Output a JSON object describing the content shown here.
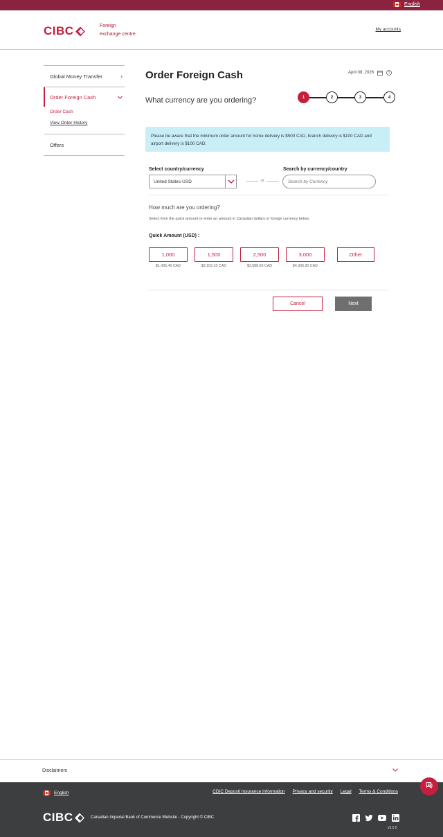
{
  "topbar": {
    "language": "English"
  },
  "header": {
    "logo_text": "CIBC",
    "app_title_line1": "Foreign",
    "app_title_line2": "exchange centre",
    "my_accounts": "My accounts"
  },
  "sidebar": {
    "global_money_transfer": "Global Money Transfer",
    "order_foreign_cash": "Order Foreign Cash",
    "order_cash": "Order Cash",
    "view_order_history": "View Order History",
    "offers": "Offers"
  },
  "main": {
    "title": "Order Foreign Cash",
    "date": "April 08, 2026",
    "question": "What currency are you ordering?",
    "steps": [
      "1",
      "2",
      "3",
      "4"
    ],
    "current_step": 1,
    "notice": "Please be aware that the minimum order amount for home delivery is $500 CAD, branch delivery is $100 CAD and airport delivery is $100 CAD.",
    "select_label": "Select country/currency",
    "select_value": "United States-USD",
    "or_text": "or",
    "search_label": "Search by currency/country",
    "search_placeholder": "Search by Currency",
    "amount_question": "How much are you ordering?",
    "amount_help": "Select from the quick amount or enter an amount in Canadian dollars or foreign currency below.",
    "quick_label": "Quick Amount (USD) :",
    "quick_amounts": [
      {
        "amount": "1,000",
        "cad": "$1,435.40 CAD"
      },
      {
        "amount": "1,500",
        "cad": "$2,153.10 CAD"
      },
      {
        "amount": "2,500",
        "cad": "$3,588.50 CAD"
      },
      {
        "amount": "3,000",
        "cad": "$4,306.20 CAD"
      }
    ],
    "other_label": "Other",
    "cancel_label": "Cancel",
    "next_label": "Next"
  },
  "disclaimers": {
    "label": "Disclaimers"
  },
  "footer": {
    "language": "English",
    "links": [
      "CDIC Deposit Insurance Information",
      "Privacy and security",
      "Legal",
      "Terms & Conditions"
    ],
    "logo_text": "CIBC",
    "copyright": "Canadian Imperial Bank of Commerce Website - Copyright © CIBC",
    "socials": [
      "facebook-icon",
      "twitter-icon",
      "youtube-icon",
      "linkedin-icon"
    ],
    "version": "v5.0.5"
  },
  "colors": {
    "brand": "#c41f3e",
    "topbar": "#8b2340",
    "notice_bg": "#c8eef6",
    "footer_bg": "#3d3e40",
    "next_bg": "#6f6f6f"
  }
}
